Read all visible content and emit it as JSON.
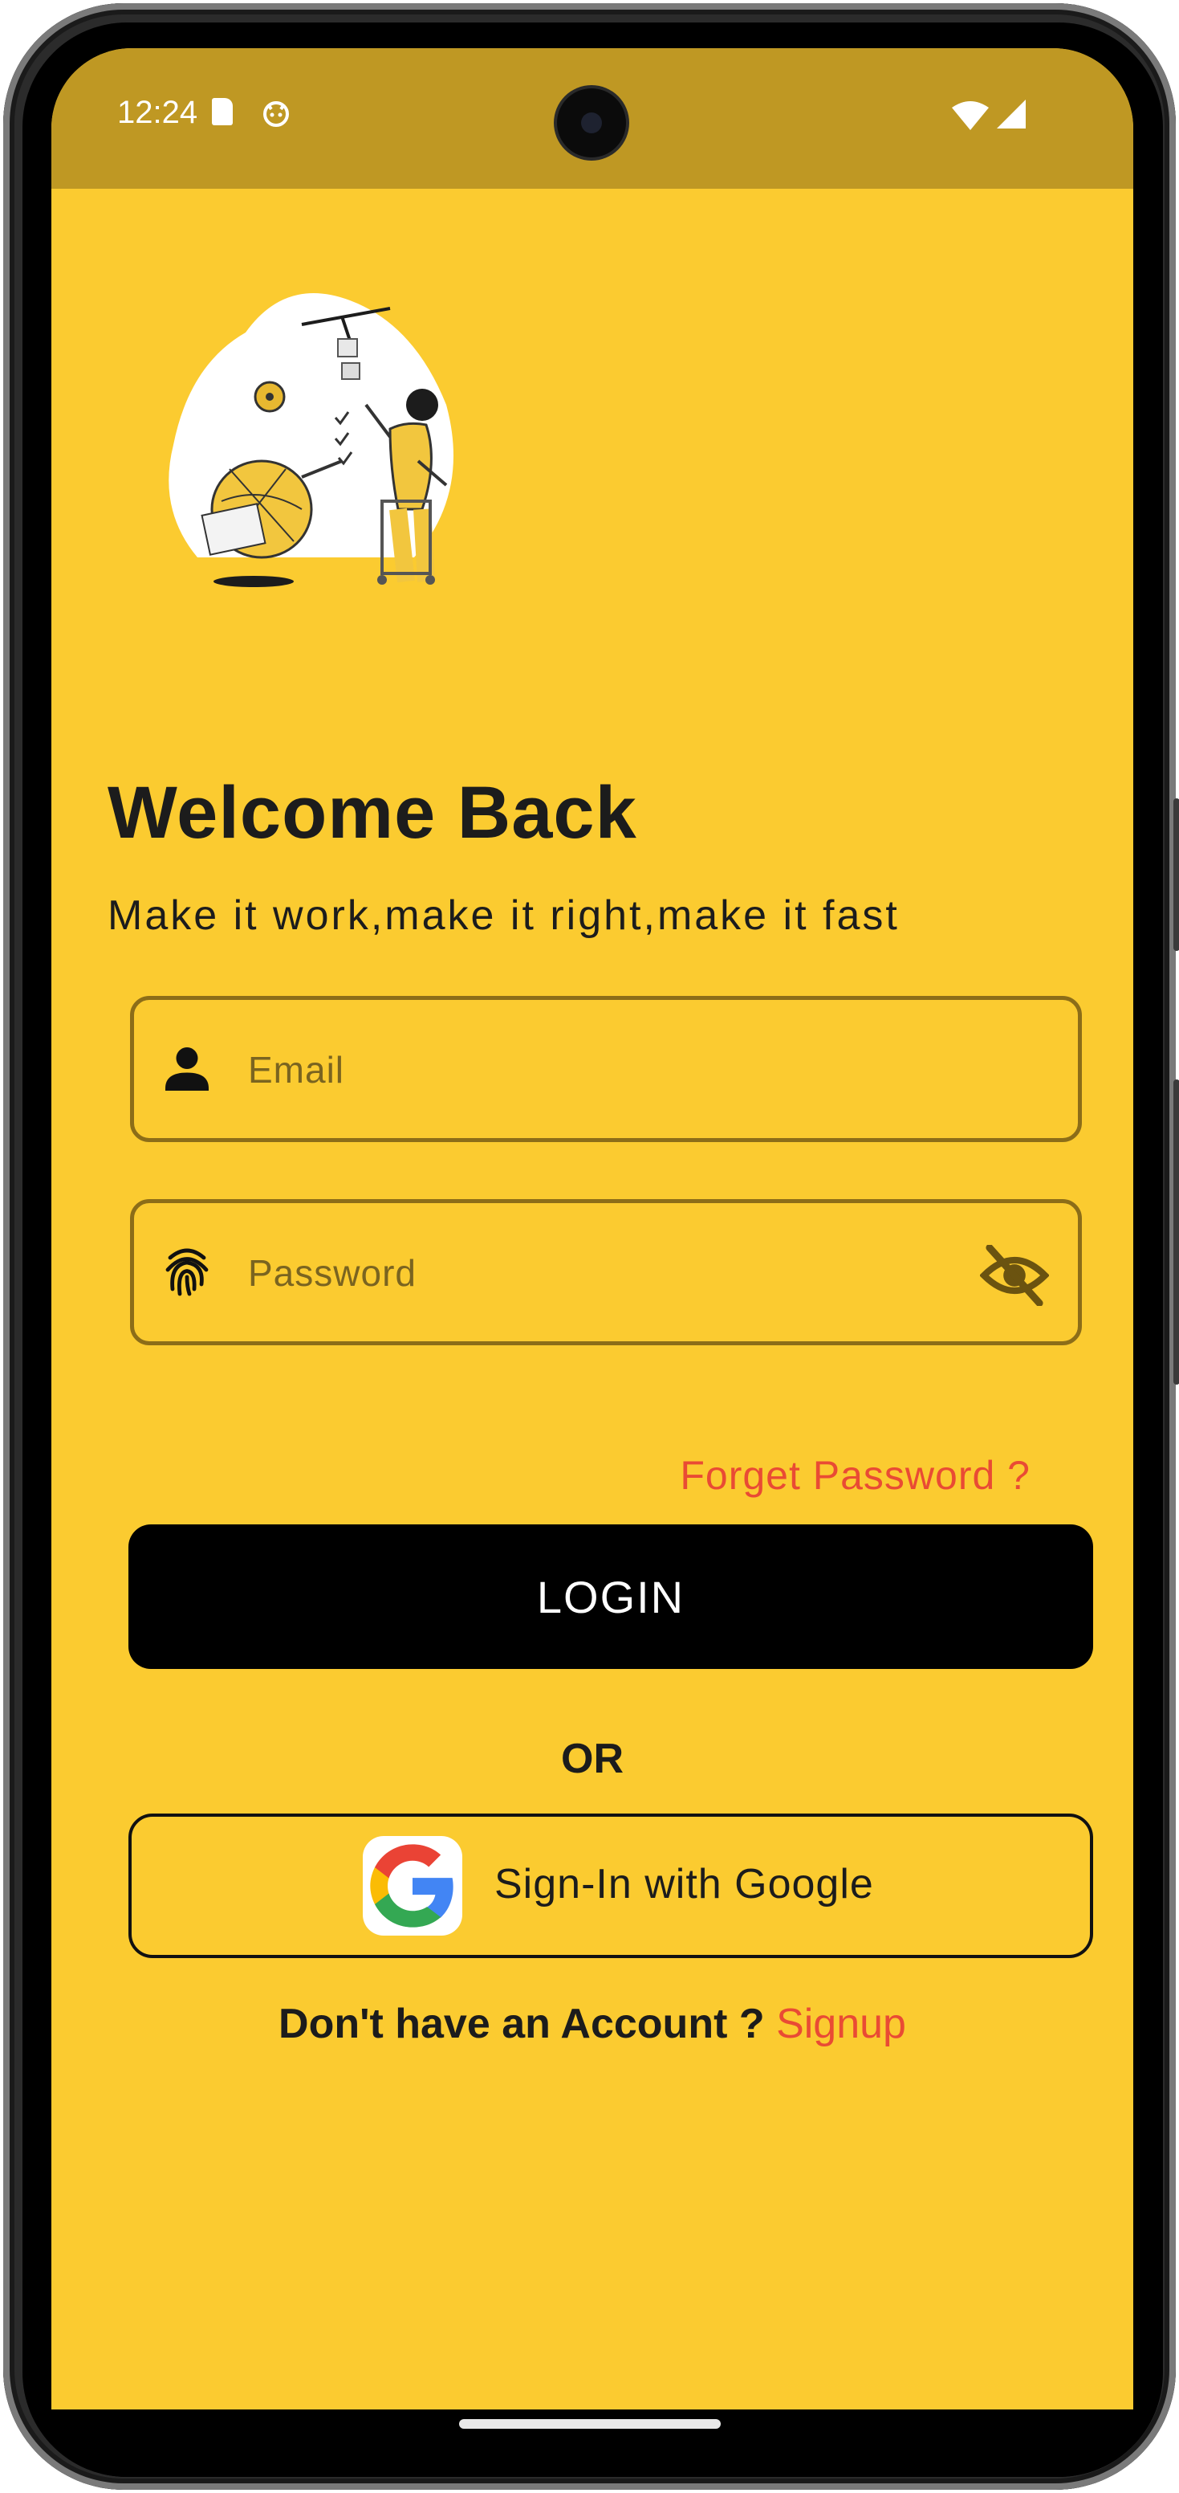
{
  "status_bar": {
    "time": "12:24",
    "icons": [
      "sd-card-icon",
      "android-robot-icon",
      "wifi-icon",
      "signal-icon"
    ]
  },
  "illustration": {
    "name": "robot-and-person-illustration"
  },
  "header": {
    "title": "Welcome Back",
    "subtitle": "Make it work,make it right,make it fast"
  },
  "form": {
    "email": {
      "placeholder": "Email",
      "value": "",
      "icon": "person-icon"
    },
    "password": {
      "placeholder": "Password",
      "value": "",
      "icon": "fingerprint-icon",
      "toggle_icon": "visibility-off-icon"
    },
    "forgot_label": "Forget Password ?",
    "login_label": "LOGIN",
    "or_label": "OR",
    "google_label": "Sign-In with Google",
    "signup_prompt": "Don't have an Account ?",
    "signup_link": "Signup"
  },
  "colors": {
    "background": "#FBCB30",
    "status_bar": "#BF9823",
    "accent_red": "#E94B34",
    "button": "#000000",
    "field_border": "#8C6D18"
  }
}
